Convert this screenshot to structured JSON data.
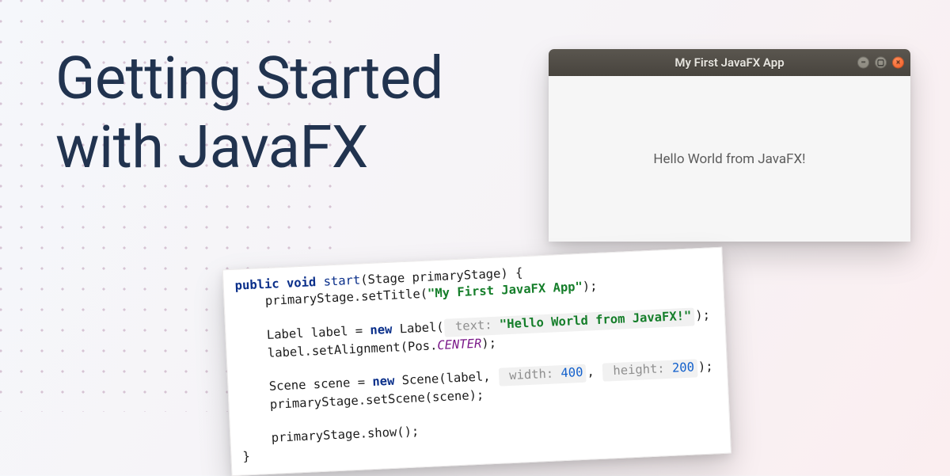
{
  "title_line1": "Getting Started",
  "title_line2": "with JavaFX",
  "app": {
    "window_title": "My First JavaFX App",
    "body_text": "Hello World from JavaFX!"
  },
  "code": {
    "kw_public": "public",
    "kw_void": "void",
    "method_name": "start",
    "param_sig": "(Stage primaryStage) {",
    "l2_head": "    primaryStage.setTitle(",
    "l2_str": "\"My First JavaFX App\"",
    "l2_tail": ");",
    "l4_head": "    Label label = ",
    "kw_new1": "new",
    "l4_ctor": " Label(",
    "hint_text_name": "text:",
    "l4_str": "\"Hello World from JavaFX!\"",
    "l4_tail": ");",
    "l5_head": "    label.setAlignment(Pos.",
    "l5_enum": "CENTER",
    "l5_tail": ");",
    "l7_head": "    Scene scene = ",
    "kw_new2": "new",
    "l7_ctor": " Scene(label, ",
    "hint_width_name": "width:",
    "hint_width_val": " 400",
    "l7_comma": ", ",
    "hint_height_name": "height:",
    "hint_height_val": " 200",
    "l7_tail": ");",
    "l8": "    primaryStage.setScene(scene);",
    "l10": "    primaryStage.show();",
    "l11": "}"
  }
}
